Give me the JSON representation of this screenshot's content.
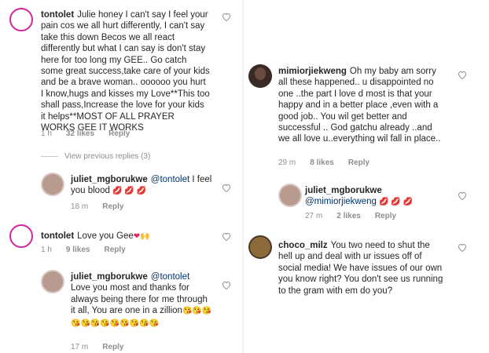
{
  "left": {
    "comment1": {
      "username": "tontolet",
      "text": "Julie honey I can't say I feel your pain cos we all hurt differently, I can't say take this down Becos we all react differently but what I can say is don't stay here for too long my GEE.. Go catch some great success,take care of your kids and be a brave woman.. oooooo you hurt I know,hugs and kisses my Love**This too shall pass,Increase the love for your kids it helps**MOST OF ALL PRAYER WORKS GEE IT WORKS",
      "time": "1 h",
      "likes": "32 likes",
      "reply": "Reply"
    },
    "view_replies": "View previous replies (3)",
    "reply1": {
      "username": "juliet_mgborukwe",
      "mention": "@tontolet",
      "text": " I feel you blood",
      "emoji": "💋 💋 💋",
      "time": "18 m",
      "reply": "Reply"
    },
    "comment2": {
      "username": "tontolet",
      "text": "Love you Gee",
      "emoji": "❤🙌",
      "time": "1 h",
      "likes": "9 likes",
      "reply": "Reply"
    },
    "reply2": {
      "username": "juliet_mgborukwe",
      "mention": "@tontolet",
      "text": "Love you most and thanks for always being there for me through it all, You are one in a zillion",
      "emoji": "😘😘😘😘😘😘😘😘😘😘😘😘",
      "time": "17 m",
      "reply": "Reply"
    }
  },
  "right": {
    "comment1": {
      "username": "mimiorjiekweng",
      "text": "Oh my baby am sorry all these happened.. u disappointed no one ..the part I love d most is that your happy and in a better place ,even with a good job.. You wil get better and successful .. God gatchu already ..and we all love u..everything wil fall in place..",
      "time": "29 m",
      "likes": "8 likes",
      "reply": "Reply"
    },
    "reply1": {
      "username": "juliet_mgborukwe",
      "mention": "@mimiorjiekweng",
      "emoji": "💋 💋 💋",
      "time": "27 m",
      "likes": "2 likes",
      "reply": "Reply"
    },
    "comment2": {
      "username": "choco_milz",
      "text": "You two need to shut the hell up and deal with ur issues off of social media! We have issues of our own you know right? You don't see us running to the gram with em do you?"
    }
  },
  "colors": {
    "meta_grey": "#8e8e8e",
    "mention_blue": "#003569",
    "story_ring": "#d6249f"
  },
  "icons": [
    "heart-outline-icon",
    "avatar-image"
  ]
}
